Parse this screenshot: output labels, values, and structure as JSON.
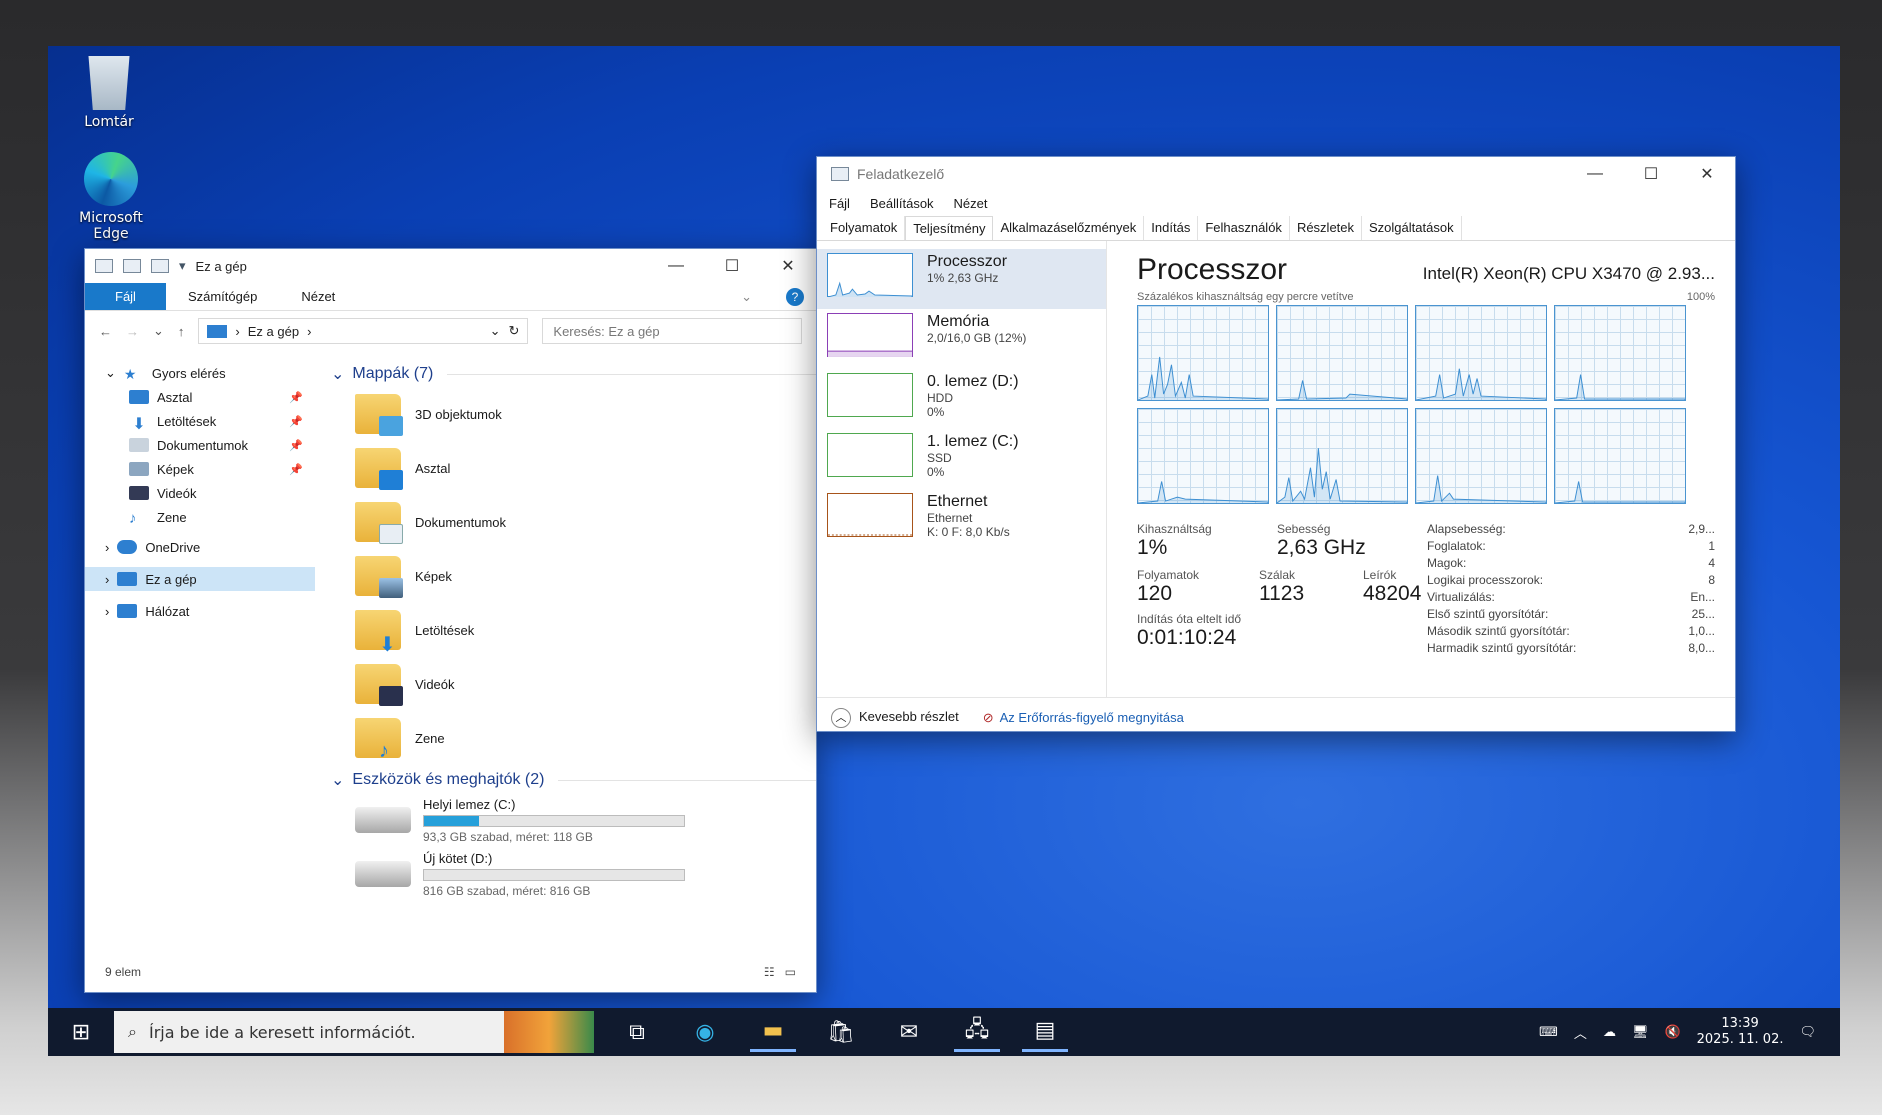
{
  "desktop": {
    "icons": [
      {
        "label": "Lomtár",
        "icon": "recycle-bin-icon"
      },
      {
        "label": "Microsoft Edge",
        "icon": "edge-icon"
      }
    ]
  },
  "explorer": {
    "title": "Ez a gép",
    "ribbon_tabs": [
      "Fájl",
      "Számítógép",
      "Nézet"
    ],
    "address": "Ez a gép",
    "search_placeholder": "Keresés: Ez a gép",
    "nav": [
      {
        "label": "Gyors elérés",
        "level": 0
      },
      {
        "label": "Asztal",
        "level": 1,
        "pinned": true
      },
      {
        "label": "Letöltések",
        "level": 1,
        "pinned": true
      },
      {
        "label": "Dokumentumok",
        "level": 1,
        "pinned": true
      },
      {
        "label": "Képek",
        "level": 1,
        "pinned": true
      },
      {
        "label": "Videók",
        "level": 1
      },
      {
        "label": "Zene",
        "level": 1
      },
      {
        "label": "OneDrive",
        "level": 0
      },
      {
        "label": "Ez a gép",
        "level": 0,
        "selected": true
      },
      {
        "label": "Hálózat",
        "level": 0
      }
    ],
    "folders_header": "Mappák (7)",
    "folders": [
      "3D objektumok",
      "Asztal",
      "Dokumentumok",
      "Képek",
      "Letöltések",
      "Videók",
      "Zene"
    ],
    "drives_header": "Eszközök és meghajtók (2)",
    "drives": [
      {
        "name": "Helyi lemez (C:)",
        "detail": "93,3 GB szabad, méret: 118 GB",
        "used_fraction": 0.21
      },
      {
        "name": "Új kötet (D:)",
        "detail": "816 GB szabad, méret: 816 GB",
        "used_fraction": 0.0
      }
    ],
    "status": "9 elem"
  },
  "taskmgr": {
    "title": "Feladatkezelő",
    "menu": [
      "Fájl",
      "Beállítások",
      "Nézet"
    ],
    "tabs": [
      "Folyamatok",
      "Teljesítmény",
      "Alkalmazáselőzmények",
      "Indítás",
      "Felhasználók",
      "Részletek",
      "Szolgáltatások"
    ],
    "active_tab": "Teljesítmény",
    "resources": [
      {
        "name": "Processzor",
        "lines": [
          "1% 2,63 GHz"
        ],
        "color": "#3d8fd2"
      },
      {
        "name": "Memória",
        "lines": [
          "2,0/16,0 GB (12%)"
        ],
        "color": "#8b3fb6"
      },
      {
        "name": "0. lemez (D:)",
        "lines": [
          "HDD",
          "0%"
        ],
        "color": "#4fa84f"
      },
      {
        "name": "1. lemez (C:)",
        "lines": [
          "SSD",
          "0%"
        ],
        "color": "#4fa84f"
      },
      {
        "name": "Ethernet",
        "lines": [
          "Ethernet",
          "K: 0 F: 8,0 Kb/s"
        ],
        "color": "#a7541a"
      }
    ],
    "perf": {
      "title": "Processzor",
      "cpu_name": "Intel(R) Xeon(R) CPU X3470 @ 2.93...",
      "subtitle": "Százalékos kihasználtság egy percre vetítve",
      "max_label": "100%",
      "stats": {
        "usage_label": "Kihasználtság",
        "usage": "1%",
        "speed_label": "Sebesség",
        "speed": "2,63 GHz",
        "proc_label": "Folyamatok",
        "proc": "120",
        "threads_label": "Szálak",
        "threads": "1123",
        "handles_label": "Leírók",
        "handles": "48204",
        "uptime_label": "Indítás óta eltelt idő",
        "uptime": "0:01:10:24"
      },
      "details": [
        {
          "k": "Alapsebesség:",
          "v": "2,9..."
        },
        {
          "k": "Foglalatok:",
          "v": "1"
        },
        {
          "k": "Magok:",
          "v": "4"
        },
        {
          "k": "Logikai processzorok:",
          "v": "8"
        },
        {
          "k": "Virtualizálás:",
          "v": "En..."
        },
        {
          "k": "Első szintű gyorsítótár:",
          "v": "25..."
        },
        {
          "k": "Második szintű gyorsítótár:",
          "v": "1,0..."
        },
        {
          "k": "Harmadik szintű gyorsítótár:",
          "v": "8,0..."
        }
      ]
    },
    "footer": {
      "less": "Kevesebb részlet",
      "monitor": "Az Erőforrás-figyelő megnyitása"
    }
  },
  "taskbar": {
    "search_placeholder": "Írja be ide a keresett információt.",
    "time": "13:39",
    "date": "2025. 11. 02."
  }
}
